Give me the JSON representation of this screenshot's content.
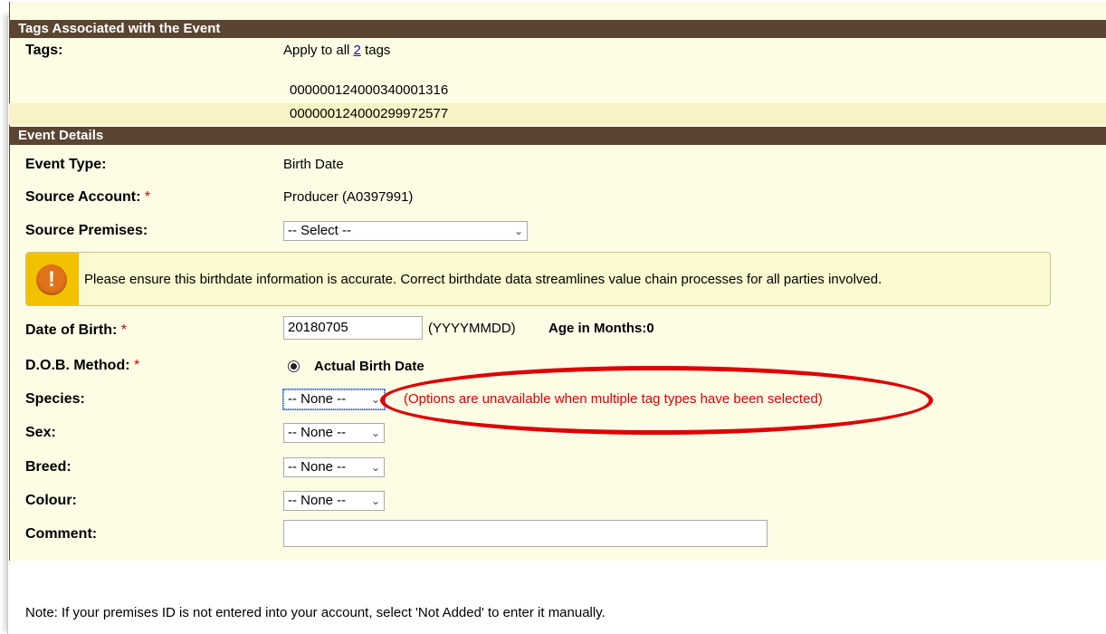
{
  "tags_section": {
    "title": "Tags Associated with the Event",
    "tags_label": "Tags:",
    "apply_prefix": "Apply to all",
    "apply_count": "2",
    "apply_suffix": "tags",
    "tags": [
      "000000124000340001316",
      "000000124000299972577"
    ]
  },
  "event_details": {
    "title": "Event Details",
    "event_type_label": "Event Type:",
    "event_type_value": "Birth Date",
    "source_account_label": "Source Account:",
    "source_account_value": "Producer (A0397991)",
    "source_premises_label": "Source Premises:",
    "source_premises_value": "-- Select --",
    "warning_text": "Please ensure this birthdate information is accurate. Correct birthdate data streamlines value chain processes for all parties involved.",
    "dob_label": "Date of Birth:",
    "dob_value": "20180705",
    "dob_format": "(YYYYMMDD)",
    "age_label": "Age in Months:0",
    "dob_method_label": "D.O.B. Method:",
    "dob_method_value": "Actual Birth Date",
    "species_label": "Species:",
    "species_value": "-- None --",
    "species_note": "(Options are unavailable when multiple tag types have been selected)",
    "sex_label": "Sex:",
    "sex_value": "-- None --",
    "breed_label": "Breed:",
    "breed_value": "-- None --",
    "colour_label": "Colour:",
    "colour_value": "-- None --",
    "comment_label": "Comment:",
    "comment_value": "",
    "required_mark": "*"
  },
  "note": "Note: If your premises ID is not entered into your account, select 'Not Added' to enter it manually.",
  "icons": {
    "warning": "exclamation-icon",
    "dropdown": "chevron-down-icon"
  },
  "colors": {
    "header_bg": "#5a4532",
    "panel_bg": "#fdfde6",
    "alt_row_bg": "#f8f3c6",
    "required": "#d00000",
    "annotation": "#e00000"
  }
}
